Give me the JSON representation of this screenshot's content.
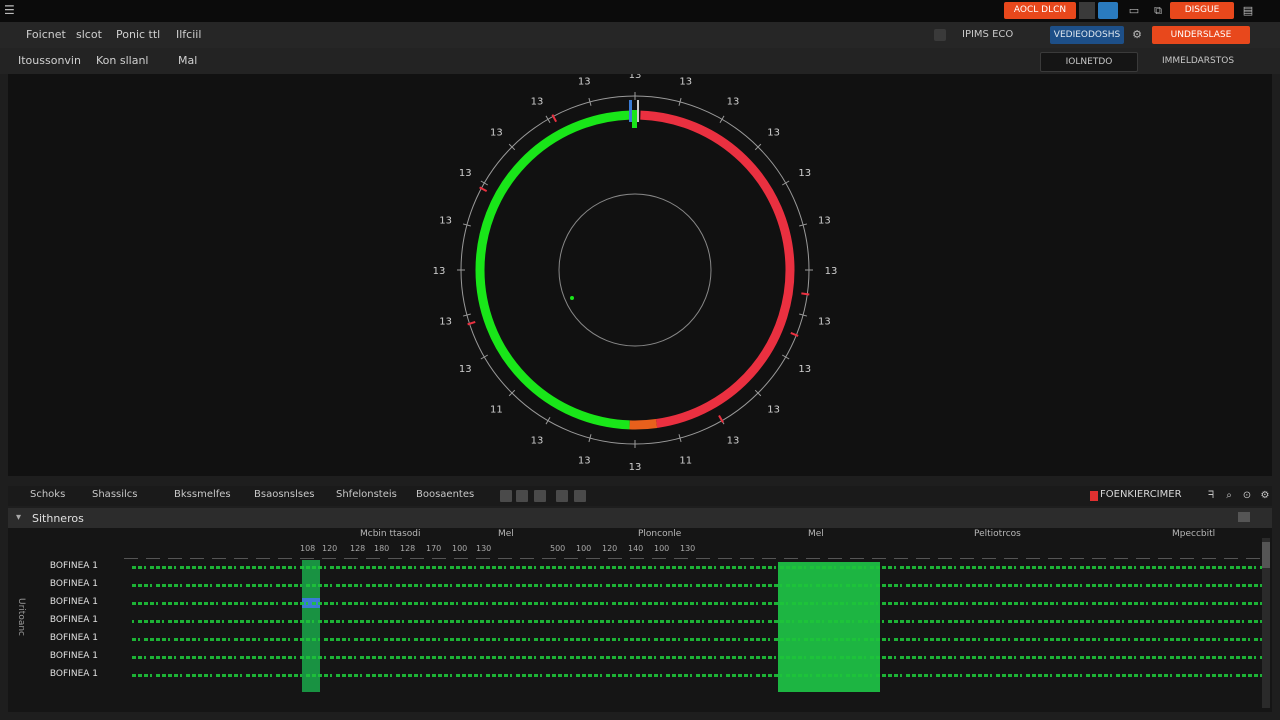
{
  "titlebar": {
    "alert_label": "AOCL DLCN",
    "status_label": "DISGUE",
    "app_icon": "grid-icon"
  },
  "menu": {
    "items": [
      "Foicnet",
      "slcot",
      "Ponic ttl",
      "Ilfciil"
    ],
    "search_value": "IPIMS ECO",
    "channel_label": "VEDIEODOSHS",
    "record_label": "UNDERSLASE"
  },
  "toolbar2": {
    "items": [
      "Itoussonvin",
      "Kon sllanl",
      "Mal"
    ],
    "dropdown_label": "IOLNETDO",
    "view_label": "IMMELDARSTOS"
  },
  "viz": {
    "tick_labels": [
      "13",
      "13",
      "13",
      "13",
      "13",
      "13",
      "13",
      "13",
      "13",
      "13",
      "13",
      "11",
      "13",
      "13",
      "13",
      "11",
      "13",
      "13",
      "13",
      "13",
      "13",
      "13",
      "13",
      "13"
    ],
    "colors": {
      "green": "#19e619",
      "red": "#ea3040",
      "orange": "#e8601c",
      "blue": "#3a7bd5"
    }
  },
  "tabs": {
    "items": [
      "Schoks",
      "Shassilcs",
      "Bkssmelfes",
      "Bsaosnslses",
      "Shfelonsteis",
      "Boosaentes"
    ],
    "summary_label": "FOENKIERCIMER"
  },
  "sequences": {
    "title": "Sithneros",
    "columns": [
      "Mcbin ttasodi",
      "Mel",
      "Plonconle",
      "Mel",
      "Peltiotrcos",
      "Mpeccbitl"
    ],
    "rows": [
      "BOFINEA 1",
      "BOFINEA 1",
      "BOFINEA 1",
      "BOFINEA 1",
      "BOFINEA 1",
      "BOFINEA 1",
      "BOFINEA 1"
    ],
    "row_axis_label": "Uritoanc",
    "ruler_labels": [
      "108",
      "120",
      "128",
      "180",
      "128",
      "170",
      "100",
      "130",
      "500",
      "100",
      "120",
      "140",
      "100",
      "130"
    ]
  }
}
